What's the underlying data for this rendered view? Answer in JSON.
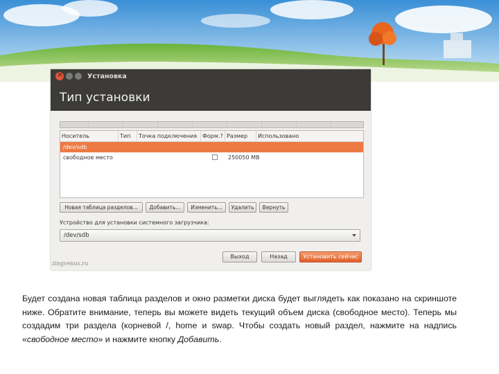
{
  "window": {
    "title": "Установка",
    "header_title": "Тип установки"
  },
  "table": {
    "columns": [
      "Носитель",
      "Тип",
      "Точка подключения",
      "Форм.?",
      "Размер",
      "Использовано"
    ],
    "rows": [
      {
        "device": "/dev/sdb",
        "type": "",
        "mount": "",
        "format": "",
        "size": "",
        "used": "",
        "selected": true
      },
      {
        "device": "свободное место",
        "type": "",
        "mount": "",
        "format": "unchecked",
        "size": "250050 MB",
        "used": "",
        "selected": false
      }
    ]
  },
  "actions": {
    "new_table": "Новая таблица разделов...",
    "add": "Добавить...",
    "change": "Изменить...",
    "delete": "Удалить",
    "revert": "Вернуть"
  },
  "bootloader": {
    "label": "Устройство для установки системного загрузчика:",
    "value": "/dev/sdb"
  },
  "nav": {
    "quit": "Выход",
    "back": "Назад",
    "install": "Установить сейчас"
  },
  "watermark": "zingvenus.ru",
  "caption": {
    "part1": "Будет создана новая таблица разделов и окно разметки диска будет выглядеть как показано на скриншоте ниже. Обратите внимание, теперь вы можете видеть текущий объем диска (свободное место). Теперь мы создадим три раздела (корневой /, home и swap. Чтобы создать новый раздел, нажмите на надпись «",
    "italic1": "свободное место",
    "part2": "» и нажмите кнопку ",
    "italic2": "Добавить",
    "part3": "."
  },
  "colors": {
    "titlebar": "#3c3b37",
    "selection": "#ee7a43",
    "primary_button": "#e0612b"
  }
}
